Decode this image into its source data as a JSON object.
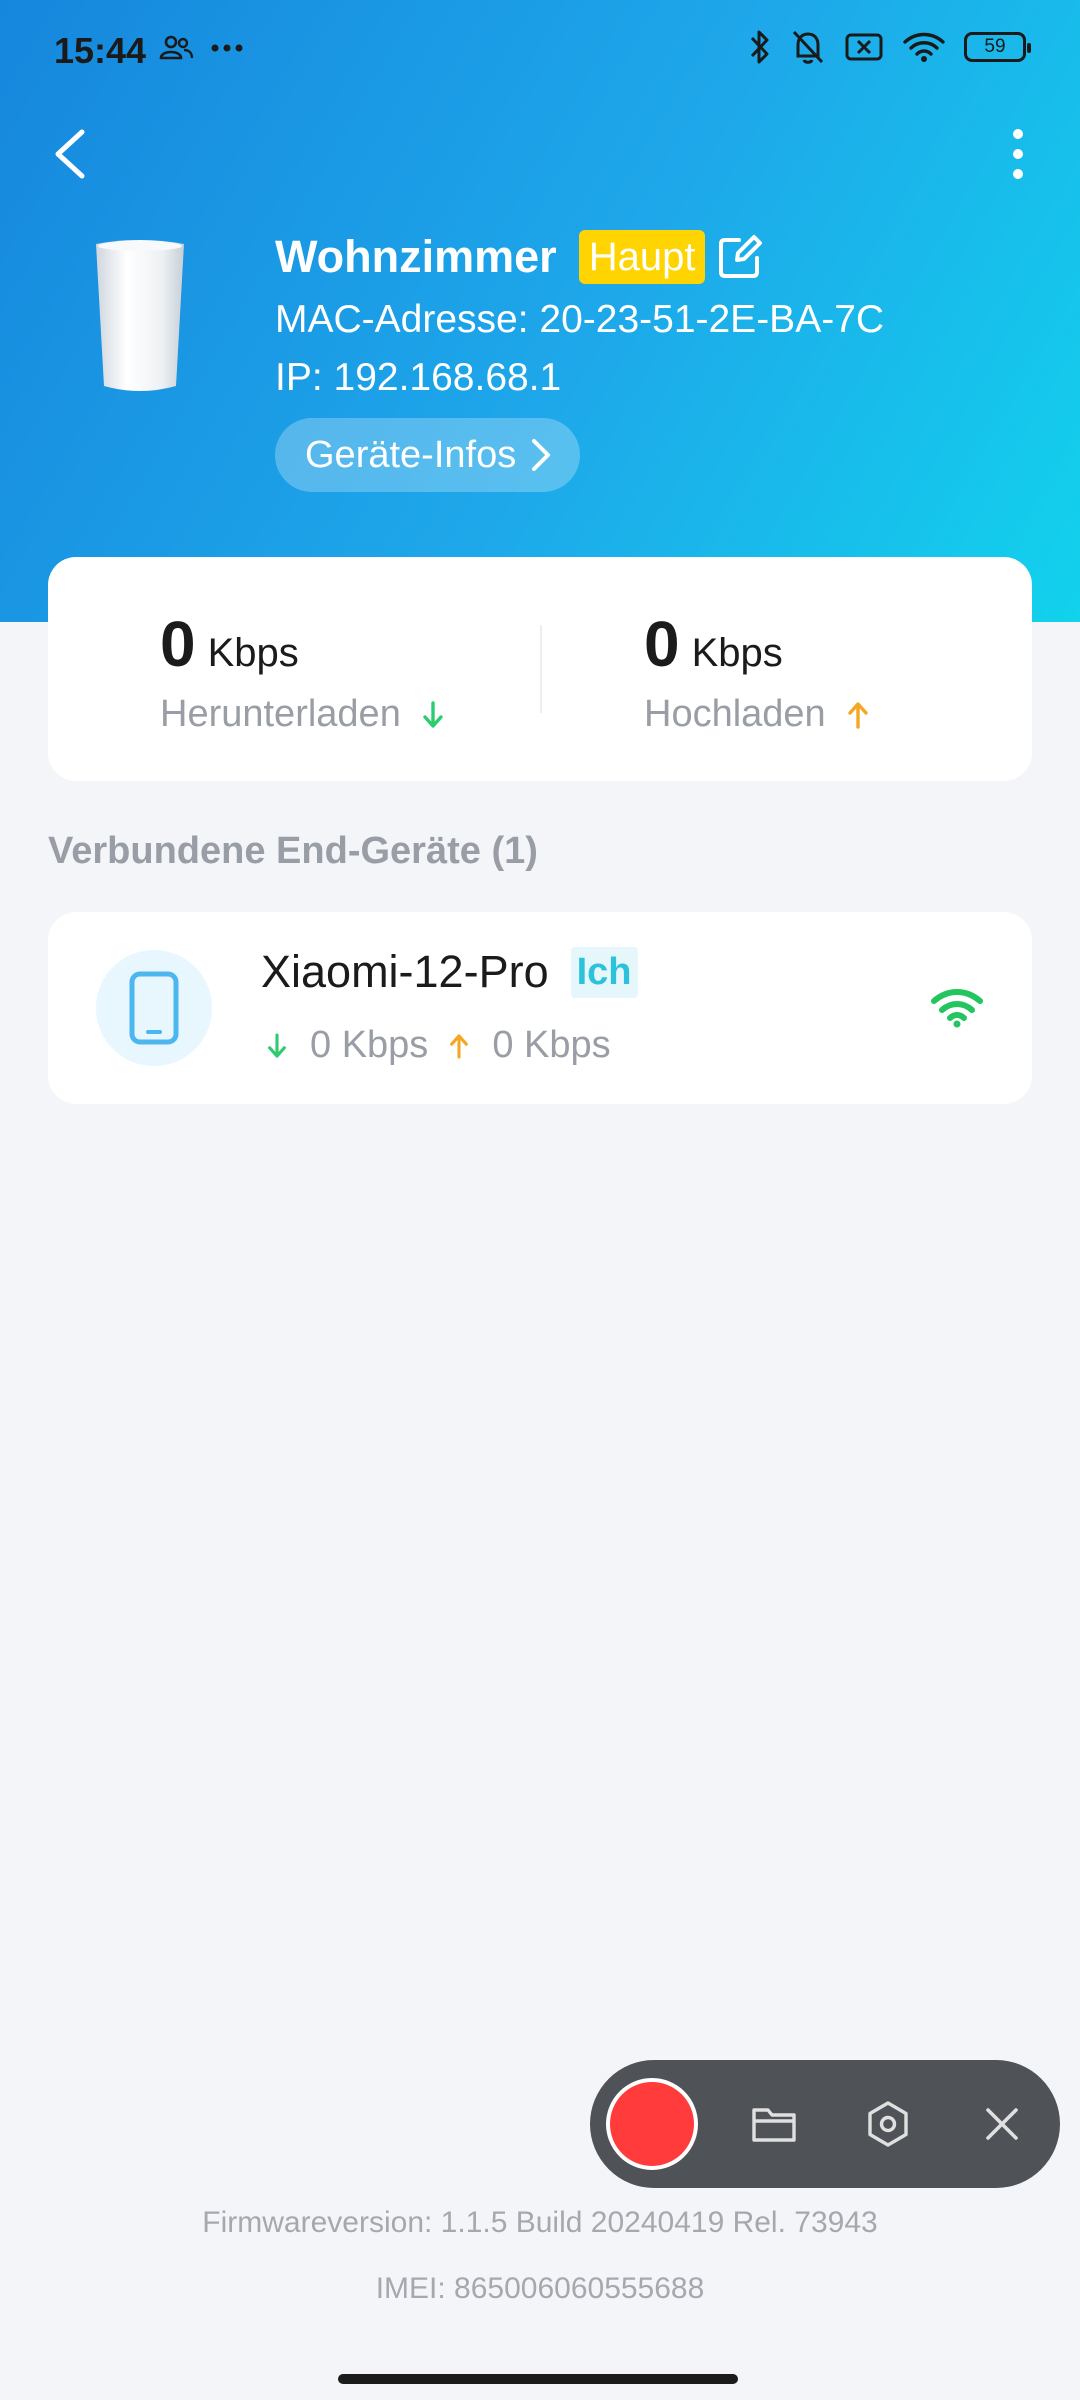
{
  "status_bar": {
    "time": "15:44",
    "battery": "59",
    "icons": [
      "people-icon",
      "more-dots-icon",
      "bluetooth-icon",
      "mute-bell-icon",
      "sim-off-icon",
      "wifi-icon",
      "battery-icon"
    ]
  },
  "router": {
    "name": "Wohnzimmer",
    "badge": "Haupt",
    "mac": "MAC-Adresse: 20-23-51-2E-BA-7C",
    "ip": "IP: 192.168.68.1",
    "info_button": "Geräte-Infos"
  },
  "speeds": {
    "download": {
      "value": "0",
      "unit": "Kbps",
      "label": "Herunterladen"
    },
    "upload": {
      "value": "0",
      "unit": "Kbps",
      "label": "Hochladen"
    }
  },
  "connected": {
    "title": "Verbundene End-Geräte (1)",
    "clients": [
      {
        "name": "Xiaomi-12-Pro",
        "badge": "Ich",
        "down": "0 Kbps",
        "up": "0 Kbps"
      }
    ]
  },
  "footer": {
    "firmware": "Firmwareversion: 1.1.5 Build 20240419 Rel. 73943",
    "imei": "IMEI: 865006060555688"
  },
  "colors": {
    "header_start": "#1687dd",
    "header_end": "#12d2ec",
    "badge_haupt": "#ffd400",
    "download_arrow": "#2ecc71",
    "upload_arrow": "#f5a623",
    "wifi_signal": "#22c55e",
    "record_red": "#ff3b3b"
  }
}
